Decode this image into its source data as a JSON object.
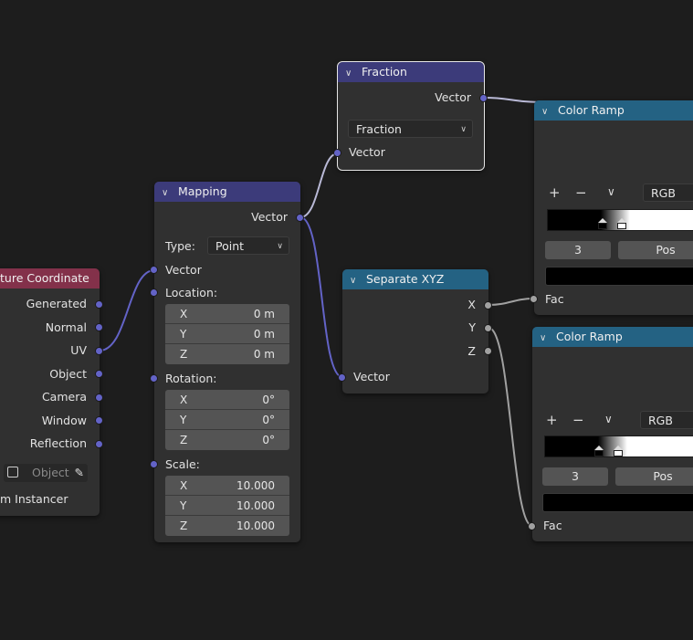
{
  "colors": {
    "background": "#1d1d1d",
    "vector_header": "#3c3b7a",
    "converter_header": "#246283",
    "input_header": "#83314a",
    "vector_socket": "#6363c7",
    "float_socket": "#a1a1a1"
  },
  "texture_coordinate": {
    "title": "ture Coordinate",
    "outputs": [
      "Generated",
      "Normal",
      "UV",
      "Object",
      "Camera",
      "Window",
      "Reflection"
    ],
    "object_field": {
      "prefix": ":",
      "placeholder": "Object",
      "icon": "eyedropper-icon"
    },
    "from_instancer": "m Instancer"
  },
  "mapping": {
    "title": "Mapping",
    "output": "Vector",
    "type_label": "Type:",
    "type_value": "Point",
    "vector_label": "Vector",
    "location_label": "Location:",
    "location": [
      {
        "axis": "X",
        "value": "0 m"
      },
      {
        "axis": "Y",
        "value": "0 m"
      },
      {
        "axis": "Z",
        "value": "0 m"
      }
    ],
    "rotation_label": "Rotation:",
    "rotation": [
      {
        "axis": "X",
        "value": "0°"
      },
      {
        "axis": "Y",
        "value": "0°"
      },
      {
        "axis": "Z",
        "value": "0°"
      }
    ],
    "scale_label": "Scale:",
    "scale": [
      {
        "axis": "X",
        "value": "10.000"
      },
      {
        "axis": "Y",
        "value": "10.000"
      },
      {
        "axis": "Z",
        "value": "10.000"
      }
    ]
  },
  "fraction": {
    "title": "Fraction",
    "output": "Vector",
    "operation": "Fraction",
    "input": "Vector"
  },
  "separate_xyz": {
    "title": "Separate XYZ",
    "outputs": [
      "X",
      "Y",
      "Z"
    ],
    "input": "Vector"
  },
  "color_ramp_1": {
    "title": "Color Ramp",
    "add": "+",
    "remove": "−",
    "menu": "∨",
    "color_mode": "RGB",
    "index": "3",
    "pos_label": "Pos",
    "input": "Fac"
  },
  "color_ramp_2": {
    "title": "Color Ramp",
    "add": "+",
    "remove": "−",
    "menu": "∨",
    "color_mode": "RGB",
    "index": "3",
    "pos_label": "Pos",
    "input": "Fac"
  }
}
